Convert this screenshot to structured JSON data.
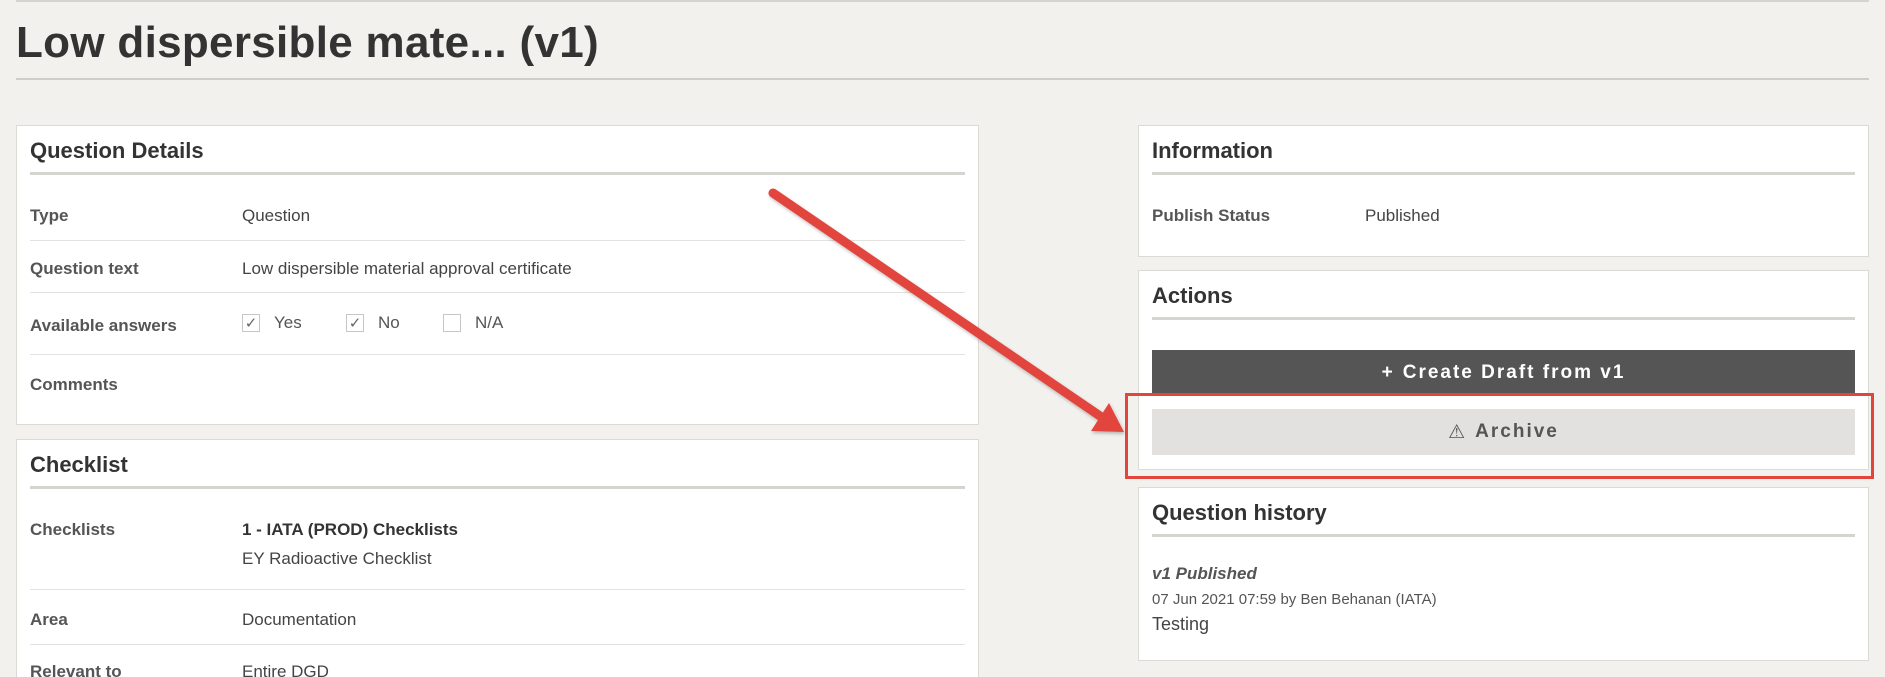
{
  "page": {
    "title": "Low dispersible mate... (v1)"
  },
  "question_details": {
    "heading": "Question Details",
    "type_label": "Type",
    "type_value": "Question",
    "text_label": "Question text",
    "text_value": "Low dispersible material approval certificate",
    "answers_label": "Available answers",
    "answers": [
      {
        "label": "Yes",
        "checked": true,
        "mark": "✓"
      },
      {
        "label": "No",
        "checked": true,
        "mark": "✓"
      },
      {
        "label": "N/A",
        "checked": false,
        "mark": ""
      }
    ],
    "comments_label": "Comments"
  },
  "checklist": {
    "heading": "Checklist",
    "checklists_label": "Checklists",
    "checklists_primary": "1 - IATA (PROD) Checklists",
    "checklists_secondary": "EY Radioactive Checklist",
    "area_label": "Area",
    "area_value": "Documentation",
    "relevant_label": "Relevant to",
    "relevant_value": "Entire DGD"
  },
  "information": {
    "heading": "Information",
    "status_label": "Publish Status",
    "status_value": "Published"
  },
  "actions": {
    "heading": "Actions",
    "create_icon": "plus-icon",
    "create_icon_glyph": "+",
    "create_label": "Create Draft from v1",
    "archive_icon": "warning-icon",
    "archive_icon_glyph": "⚠",
    "archive_label": "Archive"
  },
  "history": {
    "heading": "Question history",
    "entries": [
      {
        "version": "v1 Published",
        "meta": "07 Jun 2021 07:59 by Ben Behanan (IATA)",
        "note": "Testing"
      }
    ]
  },
  "colors": {
    "background": "#f2f1ee",
    "dark_button": "#555555",
    "light_button": "#e2e1df",
    "annotation": "#e2453c"
  }
}
